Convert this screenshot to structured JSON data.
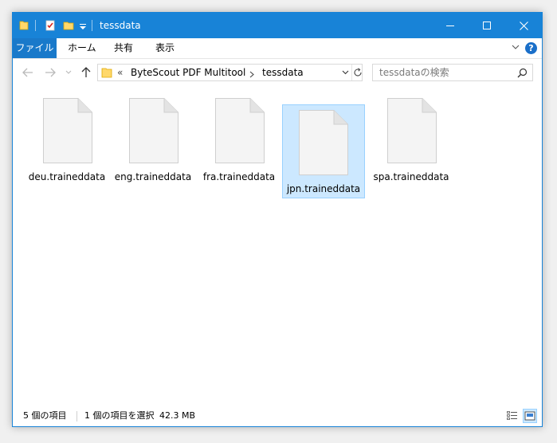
{
  "window": {
    "title": "tessdata"
  },
  "ribbon": {
    "tabs": [
      {
        "label": "ファイル"
      },
      {
        "label": "ホーム"
      },
      {
        "label": "共有"
      },
      {
        "label": "表示"
      }
    ],
    "help_label": "?"
  },
  "nav": {
    "breadcrumb_prefix": "«",
    "breadcrumb": [
      {
        "label": "ByteScout PDF Multitool"
      },
      {
        "label": "tessdata"
      }
    ],
    "search_placeholder": "tessdataの検索"
  },
  "files": [
    {
      "name": "deu.traineddata",
      "selected": false
    },
    {
      "name": "eng.traineddata",
      "selected": false
    },
    {
      "name": "fra.traineddata",
      "selected": false
    },
    {
      "name": "jpn.traineddata",
      "selected": true
    },
    {
      "name": "spa.traineddata",
      "selected": false
    }
  ],
  "status": {
    "item_count": "5 個の項目",
    "selection": "1 個の項目を選択",
    "selection_size": "42.3 MB"
  },
  "colors": {
    "accent": "#1883d7",
    "file_tab": "#1979ca",
    "selection_fill": "#cce8ff",
    "selection_border": "#99d1ff"
  }
}
